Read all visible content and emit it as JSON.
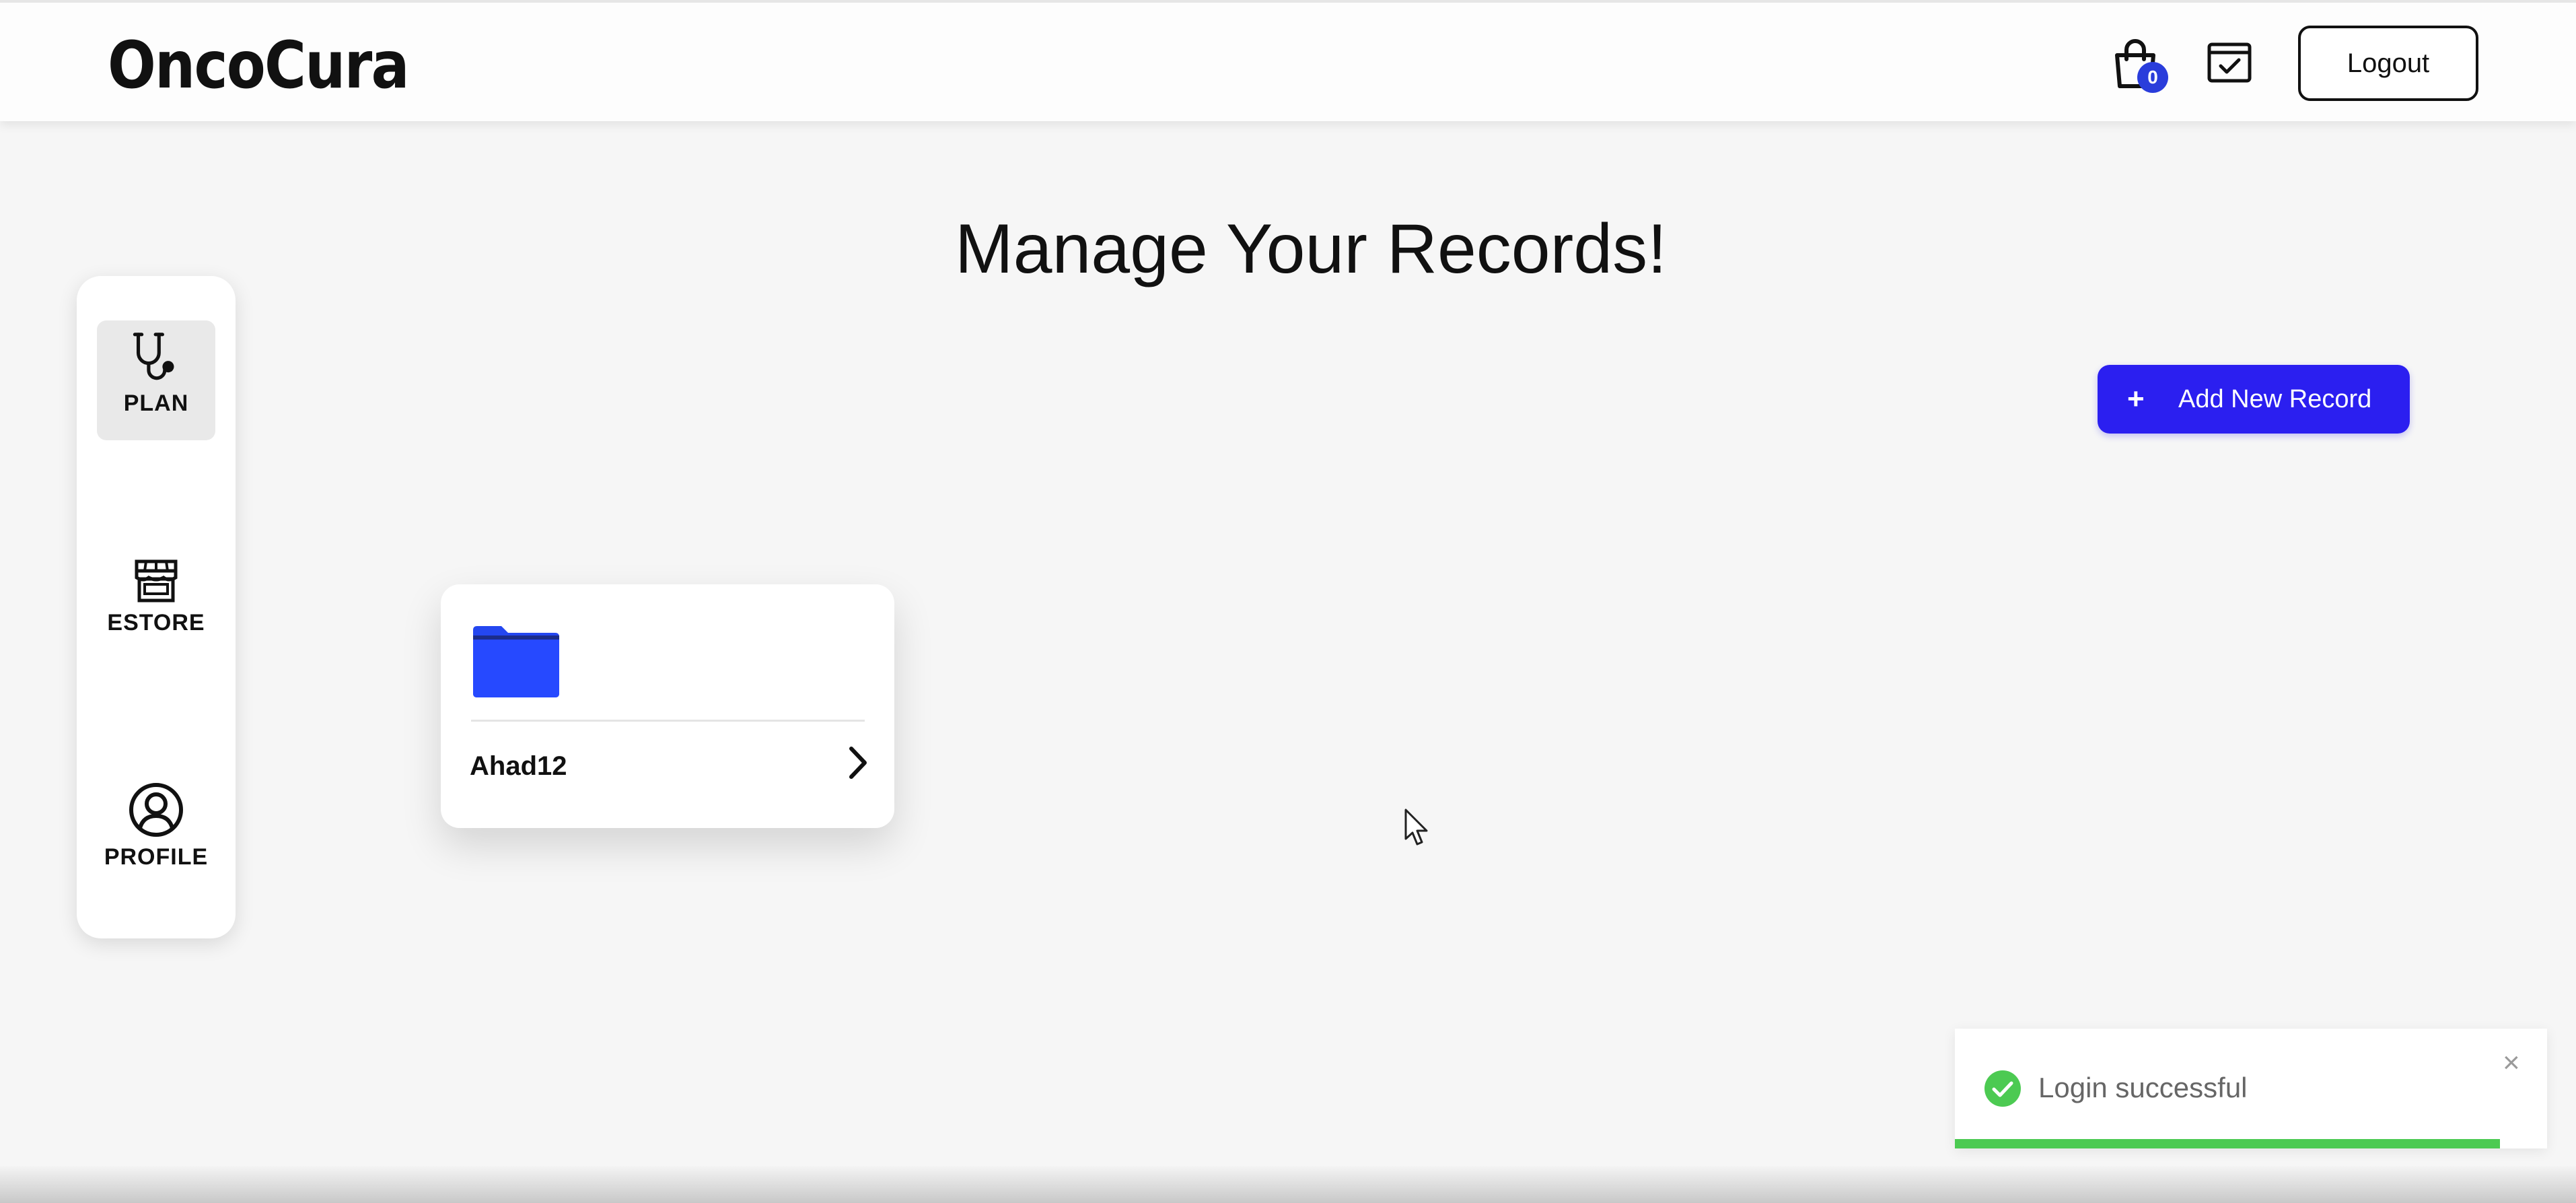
{
  "header": {
    "logo_part1": "Onco",
    "logo_part2": "Cura",
    "cart_count": "0",
    "logout_label": "Logout"
  },
  "page": {
    "title": "Manage Your Records!"
  },
  "sidebar": {
    "items": [
      {
        "label": "PLAN",
        "icon": "stethoscope-icon",
        "active": true
      },
      {
        "label": "ESTORE",
        "icon": "store-icon",
        "active": false
      },
      {
        "label": "PROFILE",
        "icon": "user-circle-icon",
        "active": false
      }
    ]
  },
  "actions": {
    "add_plus": "+",
    "add_record_label": "Add New Record"
  },
  "records": [
    {
      "name": "Ahad12",
      "icon": "folder-icon"
    }
  ],
  "toast": {
    "message": "Login successful",
    "close_symbol": "×",
    "progress_fraction": 0.92
  },
  "colors": {
    "brand_blue": "#2233dd",
    "button_blue": "#2b1ff0",
    "success_green": "#4cca52",
    "folder_blue": "#2447f0"
  }
}
